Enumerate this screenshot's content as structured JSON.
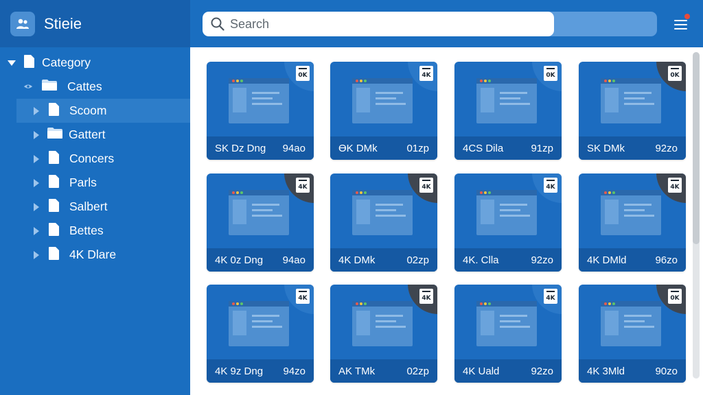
{
  "app": {
    "title": "Stieie"
  },
  "search": {
    "placeholder": "Search"
  },
  "sidebar": {
    "items": [
      {
        "label": "Category",
        "type": "file",
        "expanded": true,
        "level": 0
      },
      {
        "label": "Cattes",
        "type": "folder",
        "level": 1
      },
      {
        "label": "Scoom",
        "type": "file",
        "level": 1,
        "selected": true
      },
      {
        "label": "Gattert",
        "type": "folder",
        "level": 1
      },
      {
        "label": "Concers",
        "type": "file",
        "level": 1
      },
      {
        "label": "Parls",
        "type": "file",
        "level": 1
      },
      {
        "label": "Salbert",
        "type": "file",
        "level": 1
      },
      {
        "label": "Bettes",
        "type": "file",
        "level": 1
      },
      {
        "label": "4K Dlare",
        "type": "file",
        "level": 1
      }
    ]
  },
  "grid": {
    "cards": [
      {
        "name": "SK Dz Dng",
        "size": "94ao",
        "badge": "0K",
        "corner": "blue"
      },
      {
        "name": "ӨK DMk",
        "size": "01zp",
        "badge": "4K",
        "corner": "blue"
      },
      {
        "name": "4CS Dila",
        "size": "91zp",
        "badge": "0K",
        "corner": "blue"
      },
      {
        "name": "SK DMk",
        "size": "92zo",
        "badge": "0K",
        "corner": "dark"
      },
      {
        "name": "4K 0z Dng",
        "size": "94ao",
        "badge": "4K",
        "corner": "dark"
      },
      {
        "name": "4K DMk",
        "size": "02zp",
        "badge": "4K",
        "corner": "dark"
      },
      {
        "name": "4K. Clla",
        "size": "92zo",
        "badge": "4K",
        "corner": "blue"
      },
      {
        "name": "4K DMld",
        "size": "96zo",
        "badge": "4K",
        "corner": "dark"
      },
      {
        "name": "4K 9z Dng",
        "size": "94zo",
        "badge": "4K",
        "corner": "blue"
      },
      {
        "name": "AK TMk",
        "size": "02zp",
        "badge": "4K",
        "corner": "dark"
      },
      {
        "name": "4K Uald",
        "size": "92zo",
        "badge": "4K",
        "corner": "blue"
      },
      {
        "name": "4K 3Mld",
        "size": "90zo",
        "badge": "0K",
        "corner": "dark"
      }
    ]
  },
  "colors": {
    "accent": "#1a6ec0",
    "corner_blue": "#2a78c8",
    "corner_dark": "#3f4650",
    "notification": "#e84b3b"
  }
}
